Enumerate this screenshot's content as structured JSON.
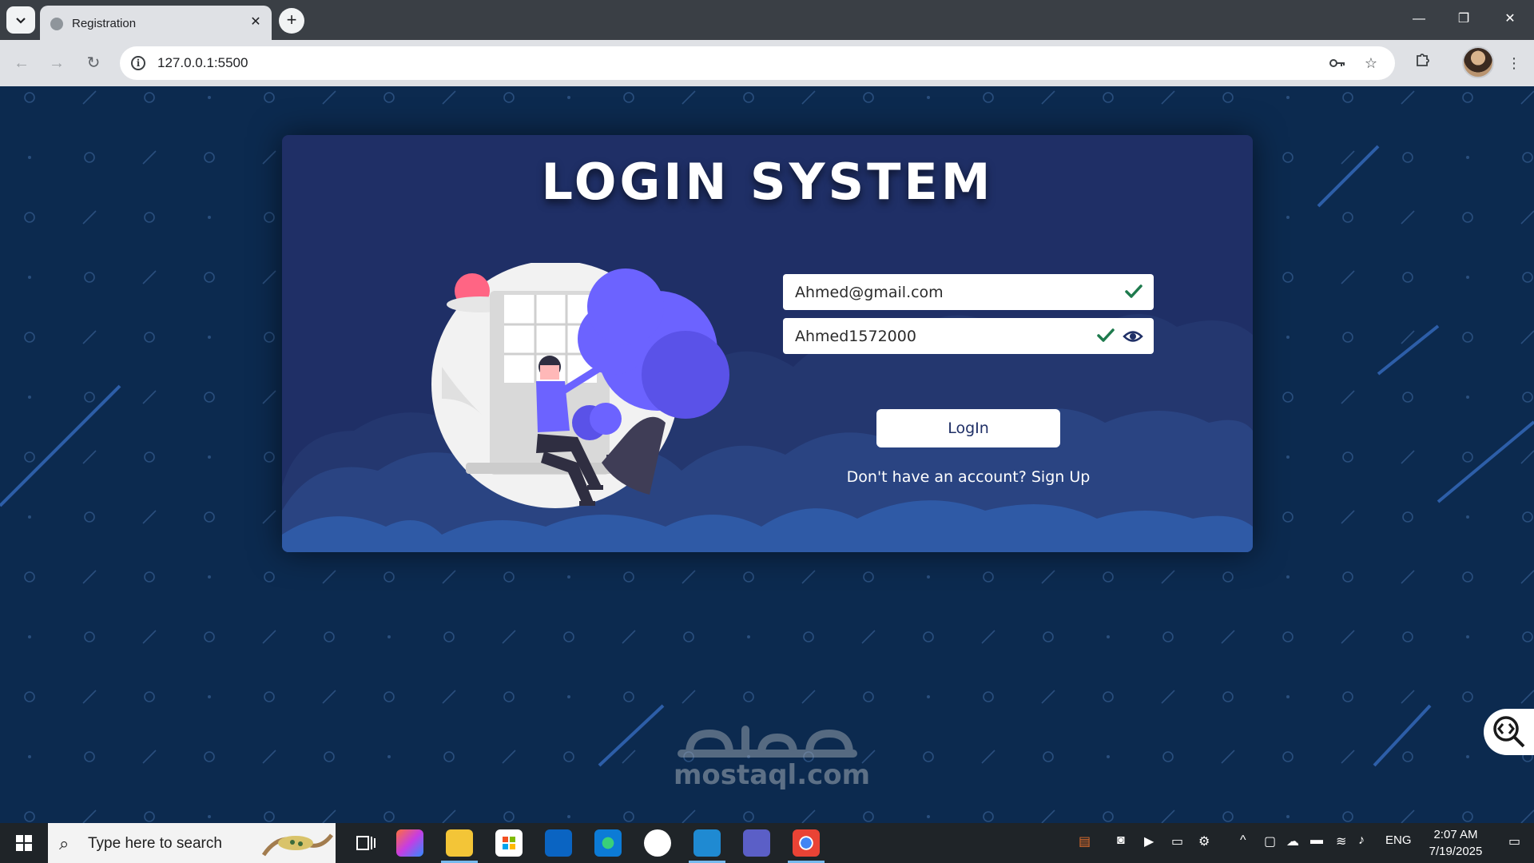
{
  "browser": {
    "tab_title": "Registration",
    "tab_close": "✕",
    "new_tab": "+",
    "url": "127.0.0.1:5500",
    "window_controls": {
      "minimize": "—",
      "maximize": "❐",
      "close": "✕"
    }
  },
  "page": {
    "title": "LOGIN SYSTEM",
    "email": {
      "value": "Ahmed@gmail.com"
    },
    "password": {
      "value": "Ahmed1572000"
    },
    "login_button": "LogIn",
    "signup_prompt": "Don't have an account? Sign Up",
    "watermark": "mostaql.com"
  },
  "taskbar": {
    "search_placeholder": "Type here to search",
    "language": "ENG",
    "time": "2:07 AM",
    "date": "7/19/2025"
  },
  "colors": {
    "page_background": "#0c2a4f",
    "card": "#1f2f66",
    "accent_purple": "#6c63ff",
    "check_green": "#1e7a4d"
  },
  "icons": [
    "tab-search-icon",
    "back-icon",
    "forward-icon",
    "reload-icon",
    "site-info-icon",
    "password-key-icon",
    "bookmark-star-icon",
    "extensions-icon",
    "menu-icon",
    "check-icon",
    "eye-icon",
    "windows-start-icon",
    "search-icon"
  ]
}
